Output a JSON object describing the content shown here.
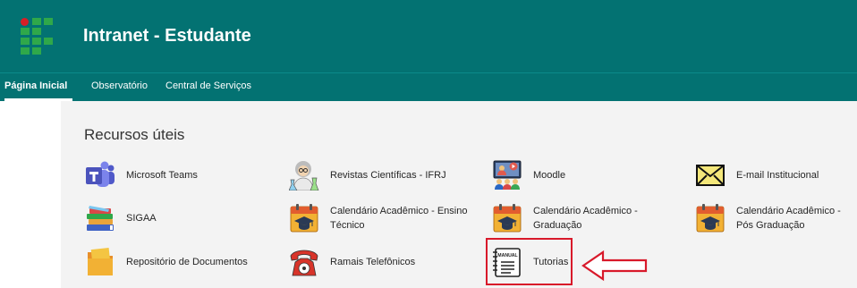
{
  "header": {
    "title": "Intranet - Estudante"
  },
  "nav": {
    "items": [
      {
        "label": "Página Inicial",
        "active": true
      },
      {
        "label": "Observatório",
        "active": false
      },
      {
        "label": "Central de Serviços",
        "active": false
      }
    ]
  },
  "section": {
    "title": "Recursos úteis"
  },
  "resources": [
    {
      "label": "Microsoft Teams",
      "icon": "microsoft-teams-icon"
    },
    {
      "label": "Revistas Científicas - IFRJ",
      "icon": "scientist-icon"
    },
    {
      "label": "Moodle",
      "icon": "video-class-icon"
    },
    {
      "label": "E-mail Institucional",
      "icon": "envelope-icon"
    },
    {
      "label": "SIGAA",
      "icon": "books-stack-icon"
    },
    {
      "label": "Calendário Acadêmico - Ensino Técnico",
      "icon": "calendar-graduation-icon"
    },
    {
      "label": "Calendário Acadêmico - Graduação",
      "icon": "calendar-graduation-icon"
    },
    {
      "label": "Calendário Acadêmico - Pós Graduação",
      "icon": "calendar-graduation-icon"
    },
    {
      "label": "Repositório de Documentos",
      "icon": "documents-folder-icon"
    },
    {
      "label": "Ramais Telefônicos",
      "icon": "telephone-icon"
    },
    {
      "label": "Tutorias",
      "icon": "manual-book-icon",
      "icon_text": "MANUAL"
    }
  ],
  "colors": {
    "brand": "#037272",
    "highlight": "#d8192a",
    "panel": "#f3f3f3",
    "logo_green": "#2fa84a",
    "logo_red": "#d71f26"
  }
}
